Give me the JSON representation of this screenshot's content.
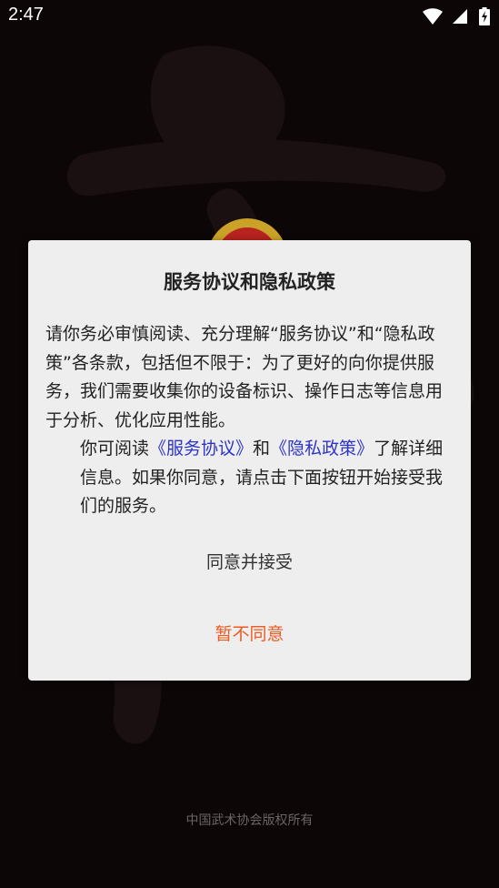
{
  "status_bar": {
    "time": "2:47",
    "icons": [
      "wifi-icon",
      "signal-icon",
      "battery-charging-icon"
    ]
  },
  "dialog": {
    "title": "服务协议和隐私政策",
    "paragraph1": "请你务必审慎阅读、充分理解“服务协议”和“隐私政策”各条款，包括但不限于：为了更好的向你提供服务，我们需要收集你的设备标识、操作日志等信息用于分析、优化应用性能。",
    "paragraph2": {
      "prefix": "你可阅读",
      "link_service": "《服务协议》",
      "conjunction": "和",
      "link_privacy": "《隐私政策》",
      "suffix": "了解详细信息。如果你同意，请点击下面按钮开始接受我们的服务。"
    },
    "agree_label": "同意并接受",
    "decline_label": "暂不同意"
  },
  "footer": {
    "copyright": "中国武术协会版权所有"
  },
  "colors": {
    "background": "#0d0607",
    "dialog_bg": "#eeeeee",
    "link": "#2d34c9",
    "decline": "#ee5a20",
    "footer_text": "#6a6465"
  }
}
